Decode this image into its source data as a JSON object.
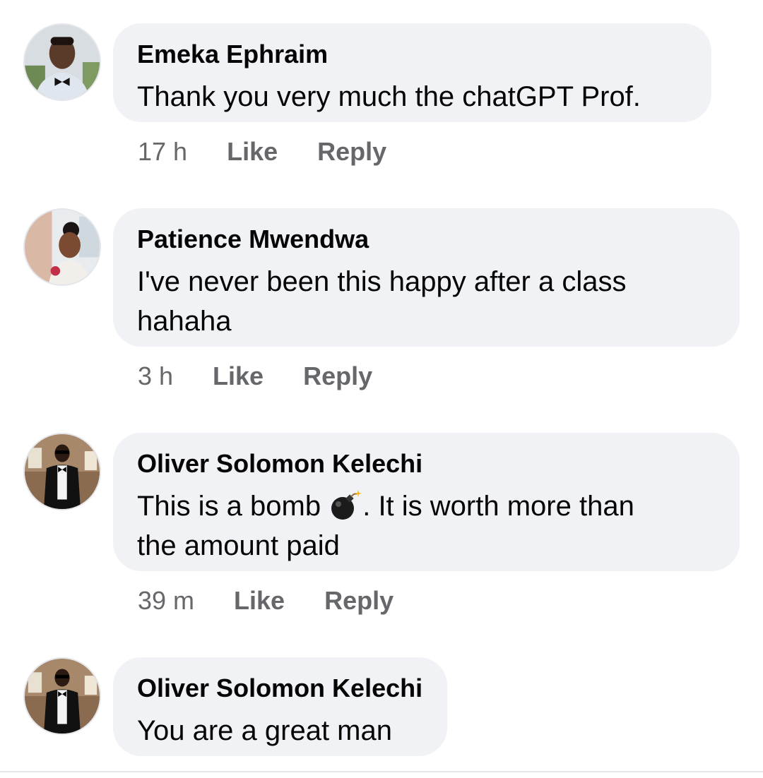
{
  "comments": [
    {
      "author": "Emeka Ephraim",
      "text": "Thank you very much the chatGPT Prof.",
      "time": "17 h",
      "like": "Like",
      "reply": "Reply"
    },
    {
      "author": "Patience Mwendwa",
      "text_line1": "I've never been this happy after a class",
      "text_line2": "hahaha",
      "time": "3 h",
      "like": "Like",
      "reply": "Reply"
    },
    {
      "author": "Oliver Solomon Kelechi",
      "text_before_icon": "This is a bomb ",
      "icon": "bomb-icon",
      "text_after_icon": ". It is worth more than",
      "text_line2": "the amount paid",
      "time": "39 m",
      "like": "Like",
      "reply": "Reply"
    },
    {
      "author": "Oliver Solomon Kelechi",
      "text": "You are a great man"
    }
  ],
  "colors": {
    "bubble": "#f0f2f5",
    "secondary_text": "#65676b",
    "primary_text": "#050505"
  }
}
